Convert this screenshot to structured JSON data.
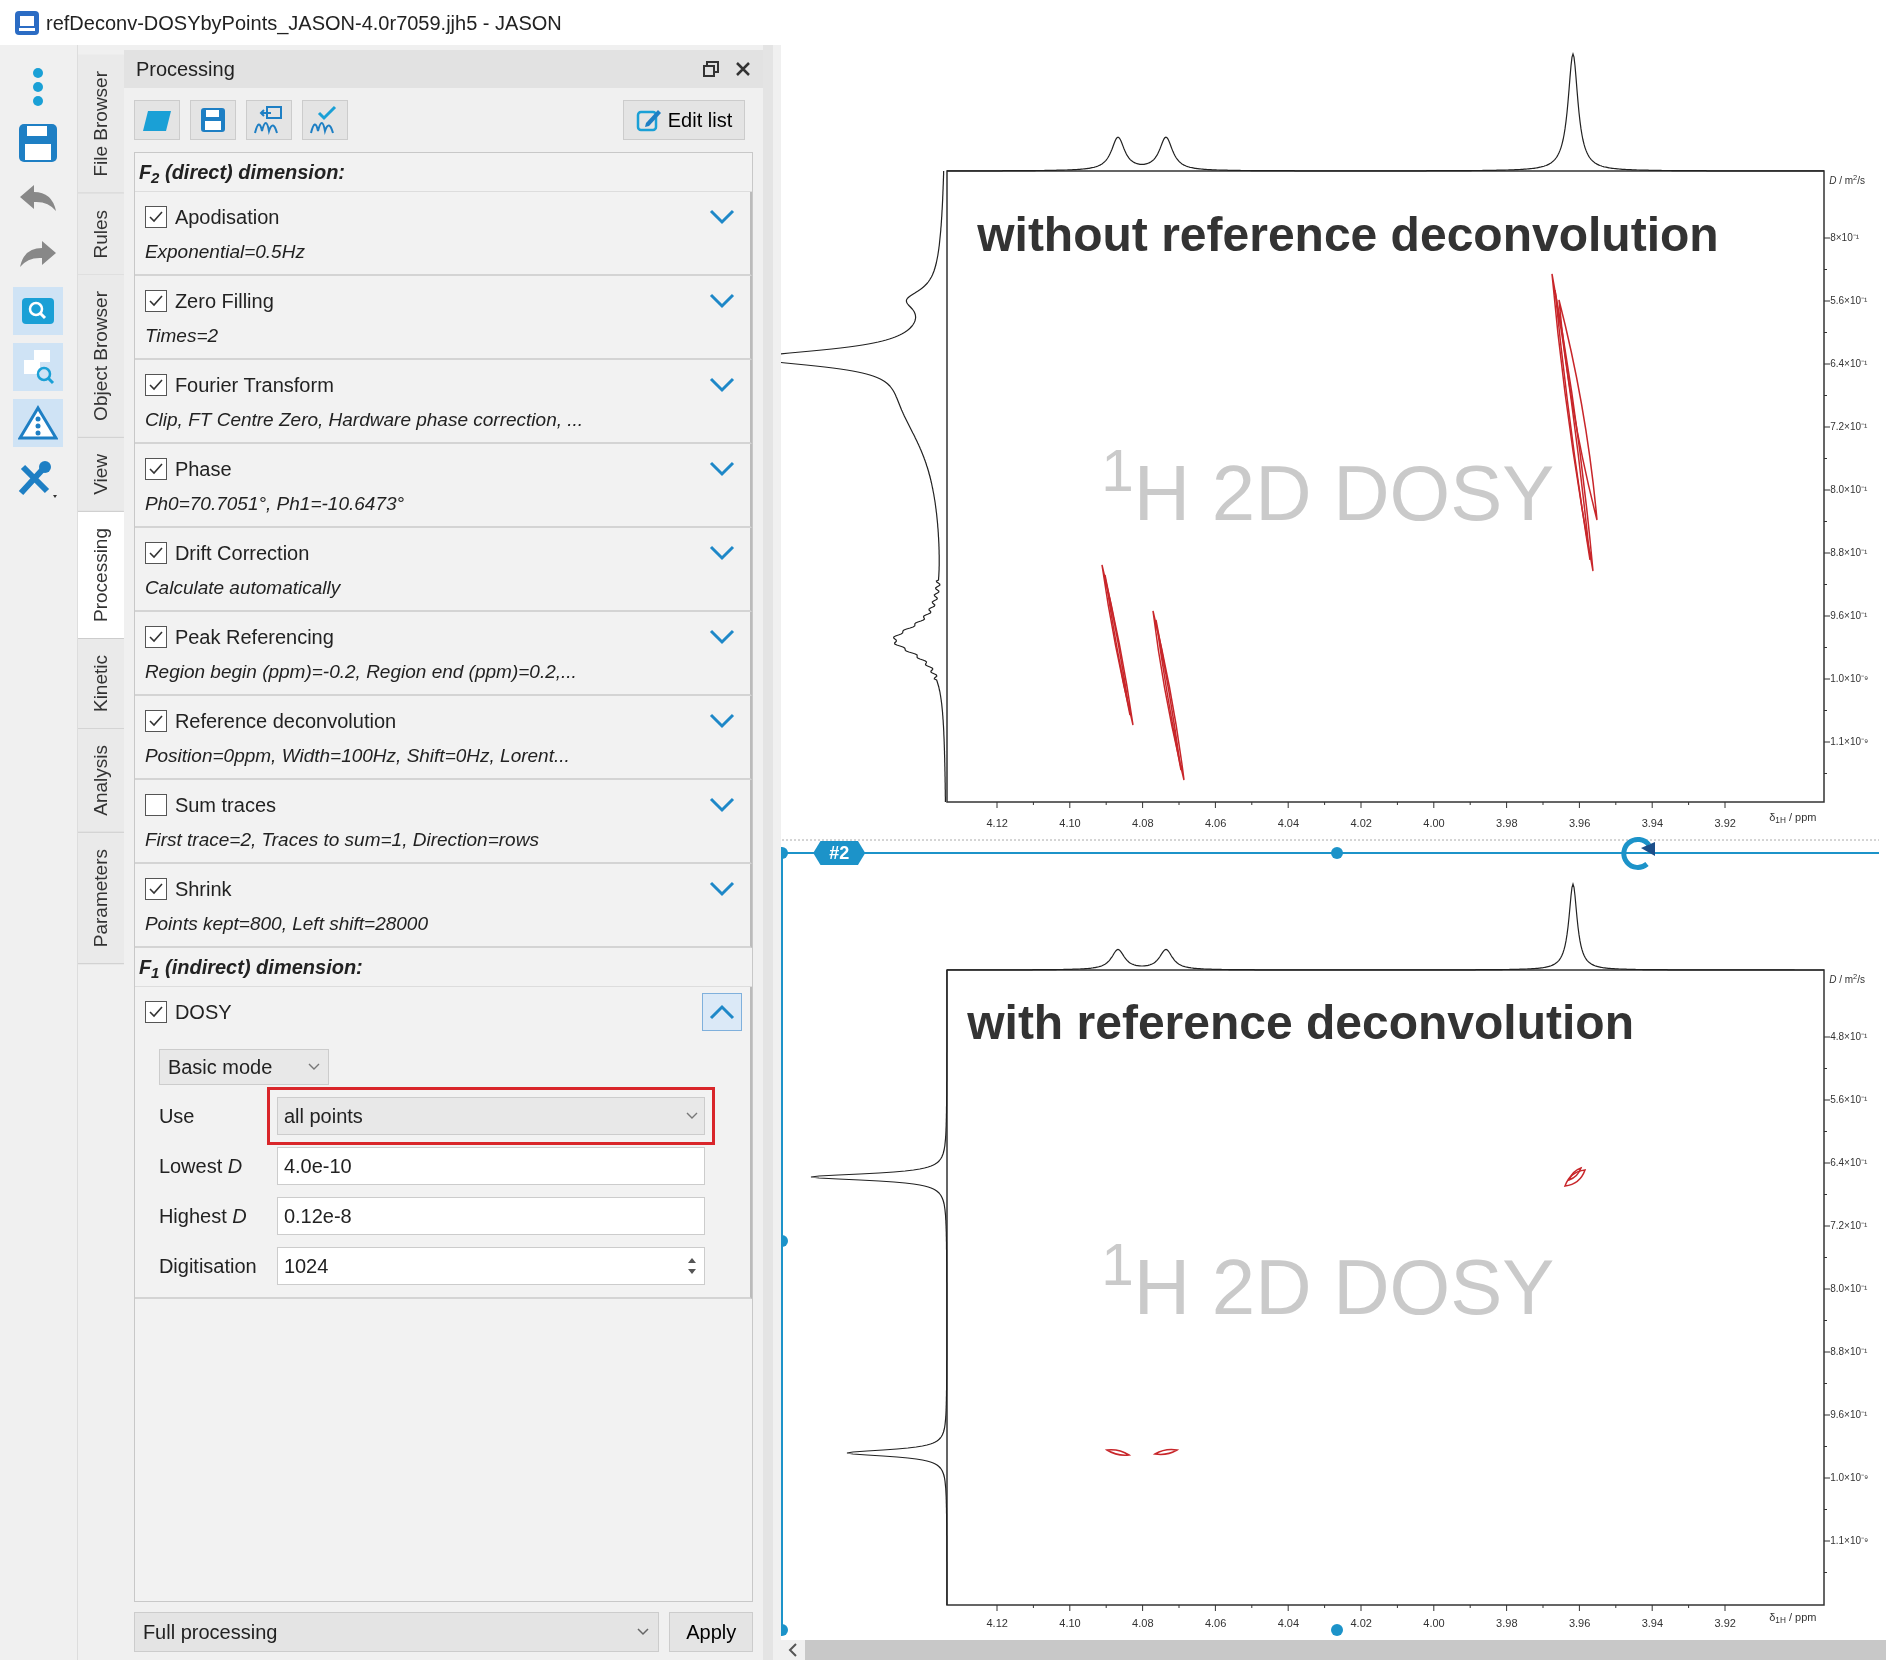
{
  "window": {
    "title": "refDeconv-DOSYbyPoints_JASON-4.0r7059.jjh5 - JASON"
  },
  "toolbar": [
    {
      "kind": "more",
      "on": false
    },
    {
      "kind": "save",
      "on": false
    },
    {
      "kind": "undo",
      "on": false
    },
    {
      "kind": "redo",
      "on": false
    },
    {
      "kind": "zoom",
      "on": true
    },
    {
      "kind": "zoom-region",
      "on": true
    },
    {
      "kind": "warning",
      "on": true
    },
    {
      "kind": "tools",
      "on": false
    }
  ],
  "side_tabs": [
    {
      "label": "File Browser",
      "selected": false
    },
    {
      "label": "Rules",
      "selected": false
    },
    {
      "label": "Object Browser",
      "selected": false
    },
    {
      "label": "View",
      "selected": false
    },
    {
      "label": "Processing",
      "selected": true
    },
    {
      "label": "Kinetic",
      "selected": false
    },
    {
      "label": "Analysis",
      "selected": false
    },
    {
      "label": "Parameters",
      "selected": false
    }
  ],
  "panel": {
    "title": "Processing",
    "edit_button": "Edit list",
    "sections": [
      {
        "heading": "F$_{2}$ (direct) dimension:",
        "steps": [
          {
            "label": "Apodisation",
            "checked": true,
            "expanded": false,
            "description": "Exponential=0.5Hz"
          },
          {
            "label": "Zero Filling",
            "checked": true,
            "expanded": false,
            "description": "Times=2"
          },
          {
            "label": "Fourier Transform",
            "checked": true,
            "expanded": false,
            "description": "Clip, FT Centre Zero, Hardware phase correction, ..."
          },
          {
            "label": "Phase",
            "checked": true,
            "expanded": false,
            "description": "Ph0=70.7051°, Ph1=-10.6473°"
          },
          {
            "label": "Drift Correction",
            "checked": true,
            "expanded": false,
            "description": "Calculate automatically"
          },
          {
            "label": "Peak Referencing",
            "checked": true,
            "expanded": false,
            "description": "Region begin (ppm)=-0.2, Region end (ppm)=0.2,..."
          },
          {
            "label": "Reference deconvolution",
            "checked": true,
            "expanded": false,
            "description": "Position=0ppm, Width=100Hz, Shift=0Hz, Lorent..."
          },
          {
            "label": "Sum traces",
            "checked": false,
            "expanded": false,
            "description": "First trace=2, Traces to sum=1, Direction=rows"
          },
          {
            "label": "Shrink",
            "checked": true,
            "expanded": false,
            "description": "Points kept=800, Left shift=28000"
          }
        ]
      },
      {
        "heading": "F$_{1}$ (indirect) dimension:",
        "steps": [
          {
            "label": "DOSY",
            "checked": true,
            "expanded": true,
            "mode": "Basic mode",
            "fields": [
              {
                "label": "Use",
                "kind": "select",
                "value": "all points",
                "highlighted": true
              },
              {
                "label": "Lowest *D*",
                "kind": "text",
                "value": "4.0e-10",
                "highlighted": false
              },
              {
                "label": "Highest *D*",
                "kind": "text",
                "value": "0.12e-8",
                "highlighted": false
              },
              {
                "label": "Digitisation",
                "kind": "spin",
                "value": "1024",
                "highlighted": false
              }
            ]
          }
        ]
      }
    ],
    "footer": {
      "select": "Full processing",
      "apply": "Apply"
    }
  },
  "plots": [
    {
      "title": "without reference deconvolution",
      "watermark": "$^{1}$H 2D DOSY",
      "xlabel": "δ$_{1H}$ / ppm",
      "ylabel": "*D* / m$^{2}$/s",
      "xticks": [
        "4.12",
        "4.10",
        "4.08",
        "4.06",
        "4.04",
        "4.02",
        "4.00",
        "3.98",
        "3.96",
        "3.94",
        "3.92"
      ],
      "yticks": [
        "8×10⁻¹",
        "5.6×10⁻¹",
        "6.4×10⁻¹",
        "7.2×10⁻¹",
        "8.0×10⁻¹",
        "8.8×10⁻¹",
        "9.6×10⁻¹",
        "1.0×10⁻⁹",
        "1.1×10⁻⁹"
      ]
    },
    {
      "title": "with reference deconvolution",
      "watermark": "$^{1}$H 2D DOSY",
      "xlabel": "δ$_{1H}$ / ppm",
      "ylabel": "*D* / m$^{2}$/s",
      "xticks": [
        "4.12",
        "4.10",
        "4.08",
        "4.06",
        "4.04",
        "4.02",
        "4.00",
        "3.98",
        "3.96",
        "3.94",
        "3.92"
      ],
      "yticks": [
        "4.8×10⁻¹",
        "5.6×10⁻¹",
        "6.4×10⁻¹",
        "7.2×10⁻¹",
        "8.0×10⁻¹",
        "8.8×10⁻¹",
        "9.6×10⁻¹",
        "1.0×10⁻⁹",
        "1.1×10⁻⁹"
      ]
    }
  ],
  "divider": {
    "badge": "#2"
  }
}
